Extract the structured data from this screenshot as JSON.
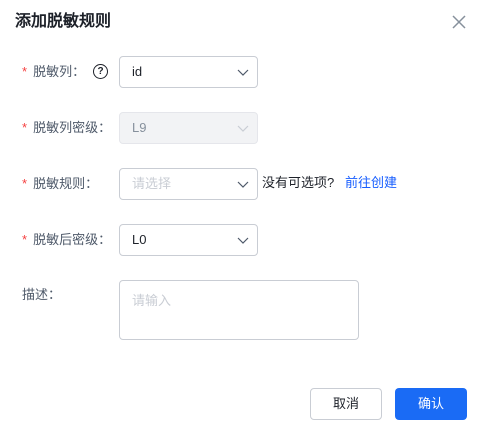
{
  "dialog": {
    "title": "添加脱敏规则",
    "close_icon": "close-icon"
  },
  "form": {
    "required_mark": "*",
    "column": {
      "label": "脱敏列：",
      "help_glyph": "?",
      "value": "id"
    },
    "column_level": {
      "label": "脱敏列密级：",
      "value": "L9",
      "disabled": true
    },
    "rule": {
      "label": "脱敏规则：",
      "placeholder": "请选择",
      "no_option_text": "没有可选项?",
      "create_link": "前往创建"
    },
    "target_level": {
      "label": "脱敏后密级：",
      "value": "L0"
    },
    "description": {
      "label": "描述：",
      "placeholder": "请输入"
    }
  },
  "footer": {
    "cancel_label": "取消",
    "ok_label": "确认"
  },
  "colors": {
    "primary": "#1a6bf5",
    "required": "#f53f3f",
    "link": "#165dff"
  }
}
